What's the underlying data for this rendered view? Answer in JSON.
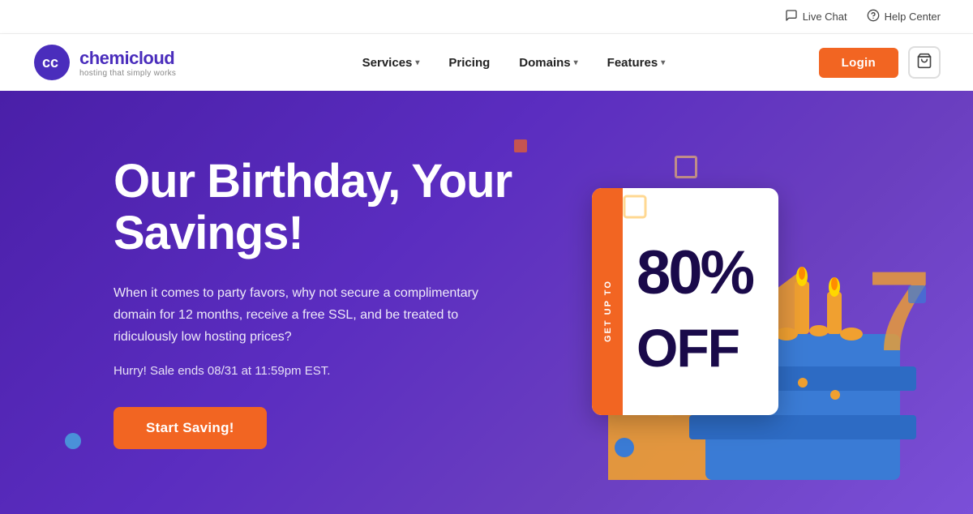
{
  "topbar": {
    "livechat_label": "Live Chat",
    "helpcenter_label": "Help Center"
  },
  "navbar": {
    "logo_name": "chemicloud",
    "logo_tagline": "hosting that simply works",
    "nav_items": [
      {
        "label": "Services",
        "has_dropdown": true
      },
      {
        "label": "Pricing",
        "has_dropdown": false
      },
      {
        "label": "Domains",
        "has_dropdown": true
      },
      {
        "label": "Features",
        "has_dropdown": true
      }
    ],
    "login_label": "Login",
    "cart_label": "Cart"
  },
  "hero": {
    "title": "Our Birthday, Your Savings!",
    "description": "When it comes to party favors, why not secure a complimentary domain for 12 months, receive a free SSL, and be treated to ridiculously low hosting prices?",
    "urgency": "Hurry! Sale ends 08/31 at 11:59pm EST.",
    "cta_label": "Start Saving!",
    "discount_badge": "GET UP TO",
    "discount_percent": "80%",
    "discount_off": "OFF"
  },
  "colors": {
    "primary": "#4a1fa8",
    "accent": "#f26522",
    "white": "#ffffff",
    "dark": "#1a0a4a"
  }
}
